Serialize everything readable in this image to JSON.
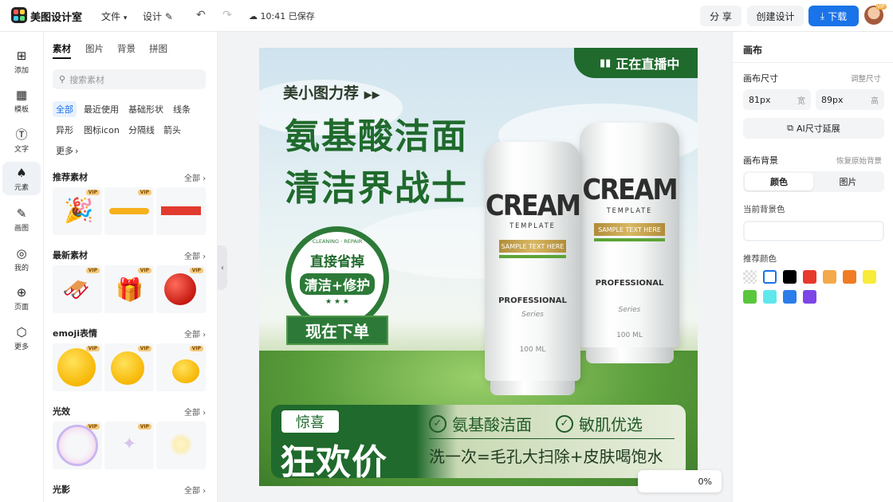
{
  "topbar": {
    "brand": "美图设计室",
    "file_menu": "文件",
    "design_name": "设计",
    "save_status": "10:41 已保存",
    "share": "分 享",
    "create_design": "创建设计",
    "download": "下载",
    "vip_badge": "VIP"
  },
  "leftnav": [
    {
      "label": "添加",
      "icon": "plus-square-icon"
    },
    {
      "label": "模板",
      "icon": "template-icon"
    },
    {
      "label": "文字",
      "icon": "text-icon"
    },
    {
      "label": "元素",
      "icon": "shapes-icon"
    },
    {
      "label": "画图",
      "icon": "draw-icon"
    },
    {
      "label": "我的",
      "icon": "user-icon"
    },
    {
      "label": "页面",
      "icon": "page-add-icon"
    },
    {
      "label": "更多",
      "icon": "cube-icon"
    }
  ],
  "panel": {
    "tabs": [
      "素材",
      "图片",
      "背景",
      "拼图"
    ],
    "search_placeholder": "搜索素材",
    "chips": [
      "全部",
      "最近使用",
      "基础形状",
      "线条",
      "异形",
      "图标icon",
      "分隔线",
      "箭头",
      "更多"
    ],
    "sections": [
      {
        "title": "推荐素材",
        "all": "全部"
      },
      {
        "title": "最新素材",
        "all": "全部"
      },
      {
        "title": "emoji表情",
        "all": "全部"
      },
      {
        "title": "光效",
        "all": "全部"
      },
      {
        "title": "光影",
        "all": "全部"
      }
    ],
    "vip_label": "VIP"
  },
  "canvas": {
    "live_tag": "正在直播中",
    "recommend": "美小图力荐",
    "headline_1": "氨基酸洁面",
    "headline_2": "清洁界战士",
    "badge_ring": "CLEANING · REPAIR",
    "badge_line1": "直接省掉",
    "badge_line2": "清洁+修护",
    "badge_stars": "★ ★ ★",
    "order_button": "现在下单",
    "tube_brand": "CREAM",
    "tube_template": "TEMPLATE",
    "tube_band": "SAMPLE TEXT HERE",
    "tube_prof": "PROFESSIONAL",
    "tube_series": "Series",
    "tube_ml": "100 ML",
    "surprise": "惊喜",
    "carnival": "狂欢价",
    "feature_1": "氨基酸洁面",
    "feature_2": "敏肌优选",
    "wash_line": "洗一次=毛孔大扫除+皮肤喝饱水"
  },
  "rightpanel": {
    "title": "画布",
    "size_label": "画布尺寸",
    "resize": "调整尺寸",
    "width_value": "81px",
    "width_unit": "宽",
    "height_value": "89px",
    "height_unit": "高",
    "ai_extend": "AI尺寸延展",
    "bg_label": "画布背景",
    "restore_bg": "恢复原始背景",
    "seg_color": "颜色",
    "seg_image": "图片",
    "current_bg": "当前背景色",
    "recommended": "推荐颜色",
    "swatches": [
      "transparent",
      "#ffffff",
      "#000000",
      "#e8382c",
      "#f4a94a",
      "#f07c24",
      "#f7ec3a",
      "#5ac63c",
      "#5ee8ee",
      "#2b7de9",
      "#7d45e8"
    ]
  },
  "zoom": {
    "value": "0%"
  }
}
